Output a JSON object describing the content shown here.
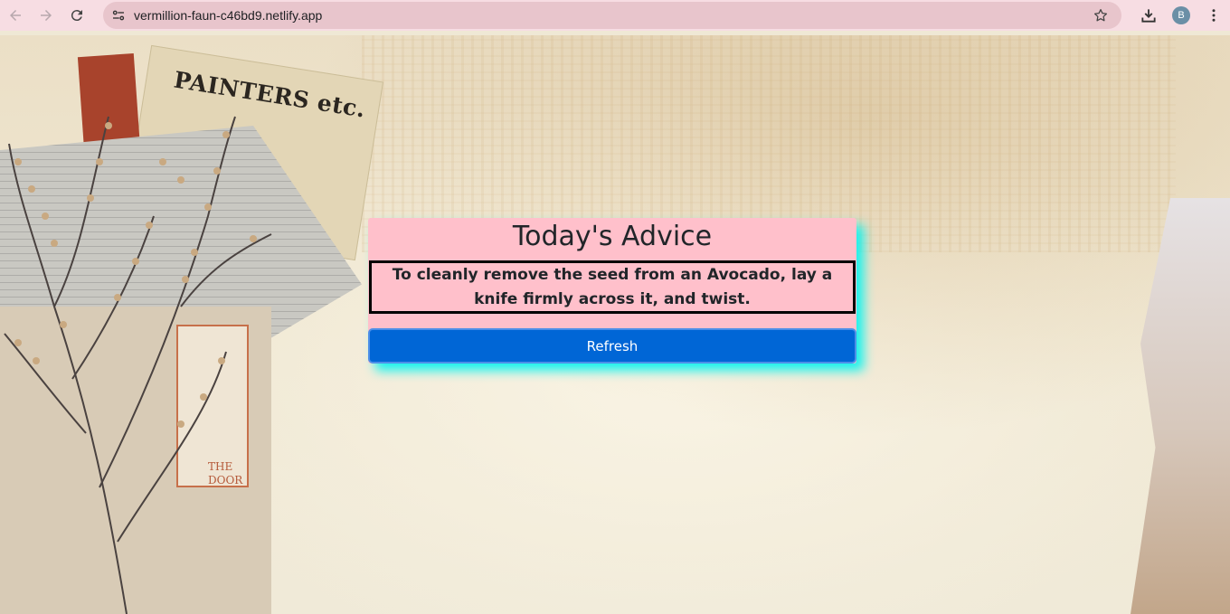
{
  "browser": {
    "url": "vermillion-faun-c46bd9.netlify.app",
    "profile_initial": "B",
    "icons": [
      "back-icon",
      "forward-icon",
      "reload-icon",
      "site-info-icon",
      "star-icon",
      "download-icon",
      "menu-icon"
    ]
  },
  "background": {
    "ticket_text": "PAINTERS etc.",
    "label_text": "THE DOOR"
  },
  "card": {
    "title": "Today's Advice",
    "advice": "To cleanly remove the seed from an Avocado, lay a knife firmly across it, and twist.",
    "button_label": "Refresh",
    "colors": {
      "card_bg": "#ffc0cb",
      "glow": "#16f3ee",
      "button_bg": "#0066d6"
    }
  }
}
